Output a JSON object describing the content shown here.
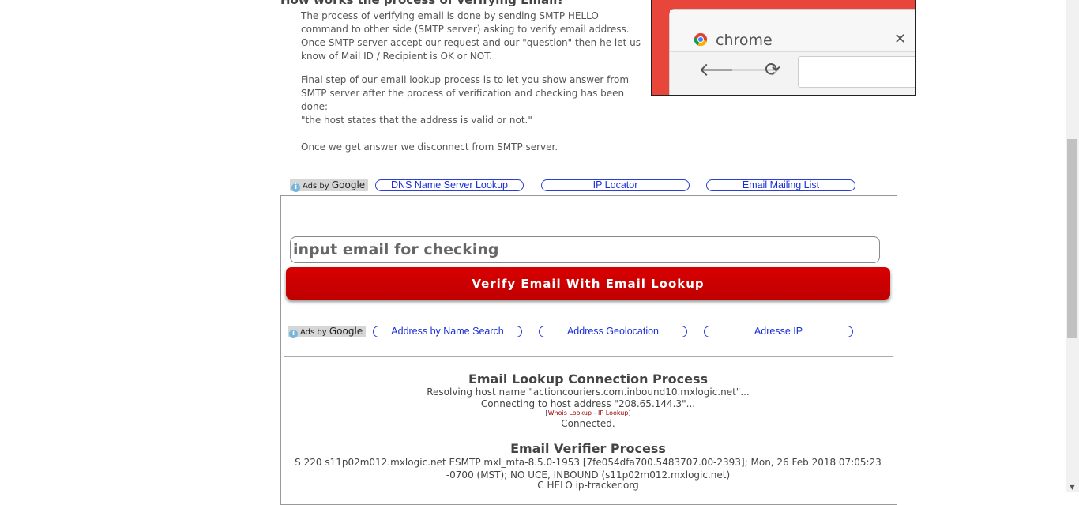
{
  "article": {
    "heading": "How works the process of verifying Email?",
    "paragraph1": "The process of verifying email is done by sending SMTP HELLO command to other side (SMTP server) asking to verify email address. Once SMTP server accept our request and our \"question\" then he let us know of Mail ID / Recipient is OK or NOT.",
    "paragraph2_a": "Final step of our email lookup process is to let you show answer from SMTP server after the process of verification and checking has been done:",
    "paragraph2_b": "\"the host states that the address is valid or not.\"",
    "paragraph3": "Once we get answer we disconnect from SMTP server."
  },
  "browser_art": {
    "tab_title": "chrome",
    "close_glyph": "✕",
    "back_glyph": "🡐",
    "forward_glyph": "🡒",
    "reload_glyph": "⟳"
  },
  "ads_top": {
    "label_prefix": "Ads by",
    "label_brand": "Google",
    "links": [
      "DNS Name Server Lookup",
      "IP Locator",
      "Email Mailing List"
    ]
  },
  "form": {
    "placeholder": "input email for checking",
    "button_label": "Verify Email With Email Lookup"
  },
  "ads_bottom": {
    "label_prefix": "Ads by",
    "label_brand": "Google",
    "links": [
      "Address by Name Search",
      "Address Geolocation",
      "Adresse IP"
    ]
  },
  "connection": {
    "title": "Email Lookup Connection Process",
    "resolving": "Resolving host name \"actioncouriers.com.inbound10.mxlogic.net\"...",
    "connecting": "Connecting to host address \"208.65.144.3\"...",
    "whois_link": "Whois Lookup",
    "ip_link": "IP Lookup",
    "connected": "Connected."
  },
  "verifier": {
    "title": "Email Verifier Process",
    "smtp_response": "S 220 s11p02m012.mxlogic.net ESMTP mxl_mta-8.5.0-1953 [7fe054dfa700.5483707.00-2393]; Mon, 26 Feb 2018 07:05:23 -0700 (MST); NO UCE, INBOUND (s11p02m012.mxlogic.net)",
    "helo": "C HELO ip-tracker.org"
  },
  "colors": {
    "button_red": "#cc0000",
    "link_blue": "#1a2ed8",
    "art_red": "#e8463a"
  }
}
